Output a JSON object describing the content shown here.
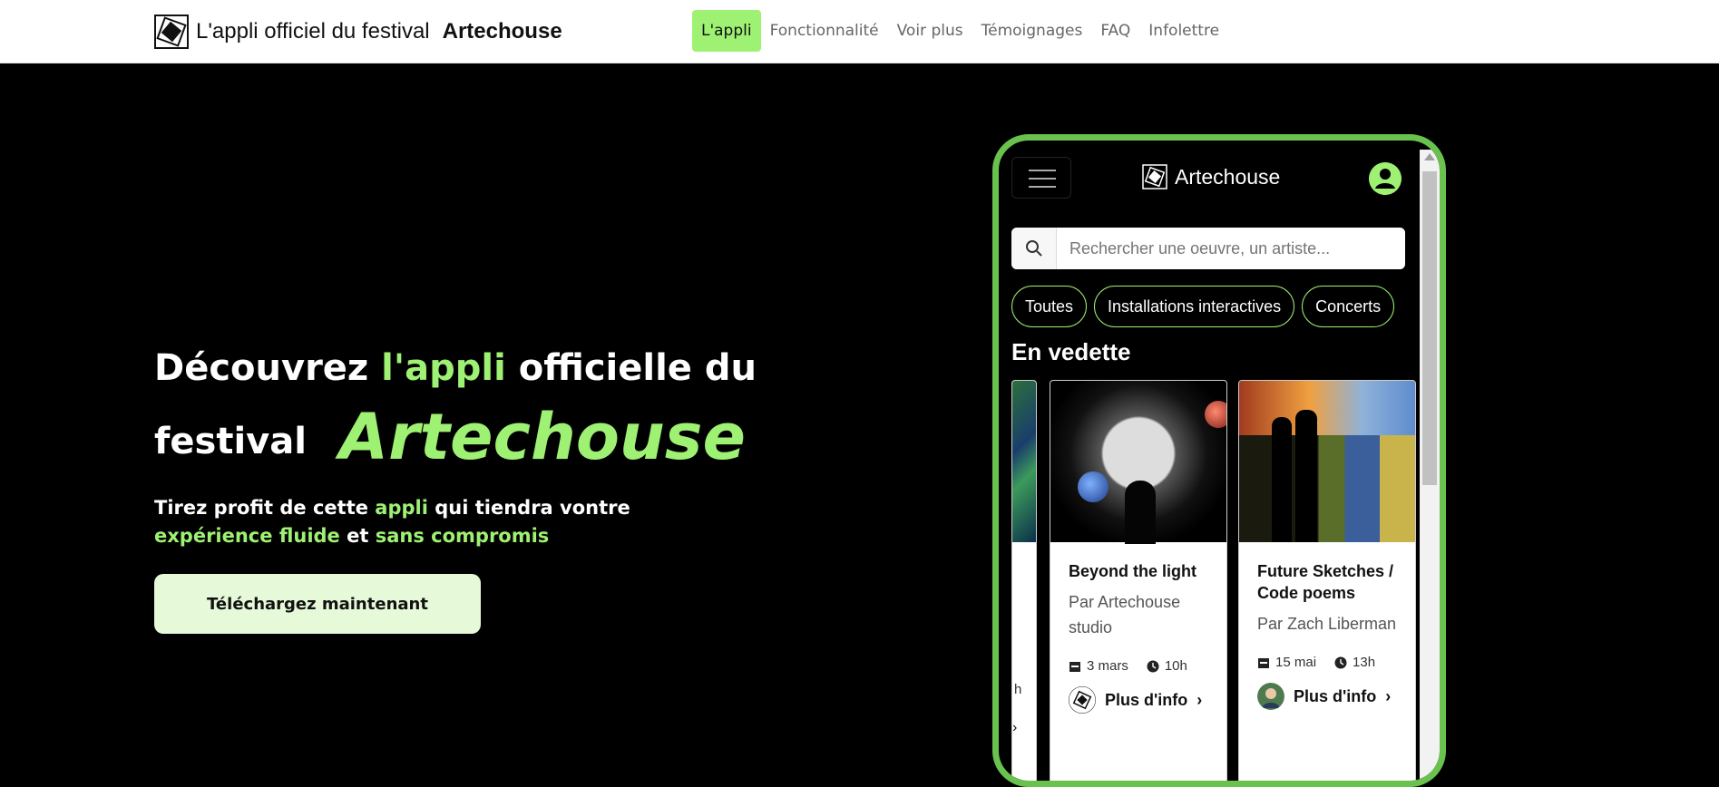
{
  "header": {
    "brand_prefix": "L'appli officiel du festival",
    "brand_name": "Artechouse",
    "nav": [
      {
        "label": "L'appli",
        "active": true
      },
      {
        "label": "Fonctionnalité",
        "active": false
      },
      {
        "label": "Voir plus",
        "active": false
      },
      {
        "label": "Témoignages",
        "active": false
      },
      {
        "label": "FAQ",
        "active": false
      },
      {
        "label": "Infolettre",
        "active": false
      }
    ]
  },
  "hero": {
    "headline_part1": "Découvrez",
    "headline_green": "l'appli",
    "headline_part2": "officielle du",
    "headline_part3": "festival",
    "headline_brand": "Artechouse",
    "sub_part1": "Tirez profit de cette",
    "sub_green1": "appli",
    "sub_part2": "qui tiendra vontre",
    "sub_green2": "expérience fluide",
    "sub_part3": "et",
    "sub_green3": "sans compromis",
    "cta_label": "Téléchargez maintenant"
  },
  "phone": {
    "app_title": "Artechouse",
    "search_placeholder": "Rechercher une oeuvre, un artiste...",
    "chips": [
      "Toutes",
      "Installations interactives",
      "Concerts"
    ],
    "featured_title": "En vedette",
    "cards": [
      {
        "title": "Beyond the light",
        "artist": "Par Artechouse studio",
        "date": "3 mars",
        "time": "10h",
        "more": "Plus d'info"
      },
      {
        "title": "Future Sketches / Code poems",
        "artist": "Par Zach Liberman",
        "date": "15 mai",
        "time": "13h",
        "more": "Plus d'info"
      }
    ],
    "partial_card_time_fragment": "h"
  },
  "colors": {
    "accent": "#9ef172",
    "frame": "#6ac24e",
    "cta_bg": "#e6f9d8"
  }
}
